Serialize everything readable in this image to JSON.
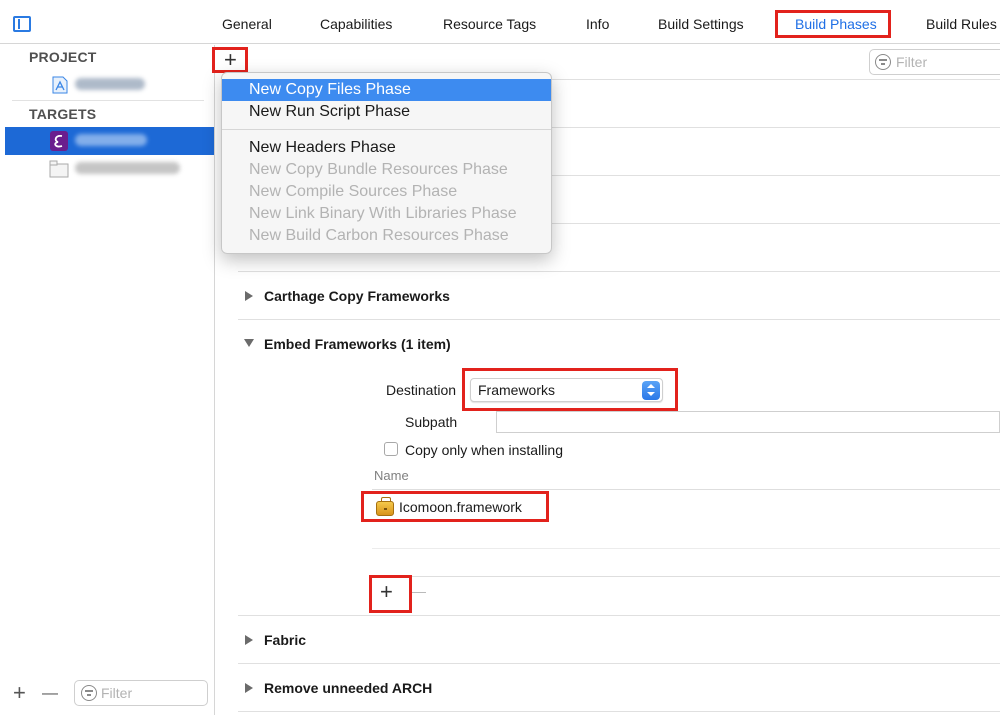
{
  "tabs": [
    {
      "label": "General"
    },
    {
      "label": "Capabilities"
    },
    {
      "label": "Resource Tags"
    },
    {
      "label": "Info"
    },
    {
      "label": "Build Settings"
    },
    {
      "label": "Build Phases",
      "active": true
    },
    {
      "label": "Build Rules"
    }
  ],
  "sidebar": {
    "project_header": "PROJECT",
    "targets_header": "TARGETS",
    "filter_placeholder": "Filter",
    "add_label": "+",
    "remove_label": "—"
  },
  "main": {
    "add_phase_label": "+",
    "filter_placeholder": "Filter",
    "menu": {
      "items": [
        {
          "label": "New Copy Files Phase",
          "state": "highlighted"
        },
        {
          "label": "New Run Script Phase",
          "state": "enabled"
        },
        {
          "label": "New Headers Phase",
          "state": "enabled"
        },
        {
          "label": "New Copy Bundle Resources Phase",
          "state": "disabled"
        },
        {
          "label": "New Compile Sources Phase",
          "state": "disabled"
        },
        {
          "label": "New Link Binary With Libraries Phase",
          "state": "disabled"
        },
        {
          "label": "New Build Carbon Resources Phase",
          "state": "disabled"
        }
      ]
    },
    "phases": {
      "carthage": "Carthage Copy Frameworks",
      "embed": "Embed Frameworks (1 item)",
      "fabric": "Fabric",
      "remove_arch": "Remove unneeded ARCH"
    },
    "embed": {
      "destination_label": "Destination",
      "destination_value": "Frameworks",
      "subpath_label": "Subpath",
      "subpath_value": "",
      "copy_only_label": "Copy only when installing",
      "name_header": "Name",
      "framework_name": "Icomoon.framework",
      "add_label": "+",
      "remove_label": "—"
    }
  },
  "colors": {
    "accent": "#1f6fe5",
    "selection": "#1d69d6",
    "highlight_box": "#e2221c",
    "menu_highlight": "#3d8bf0"
  }
}
